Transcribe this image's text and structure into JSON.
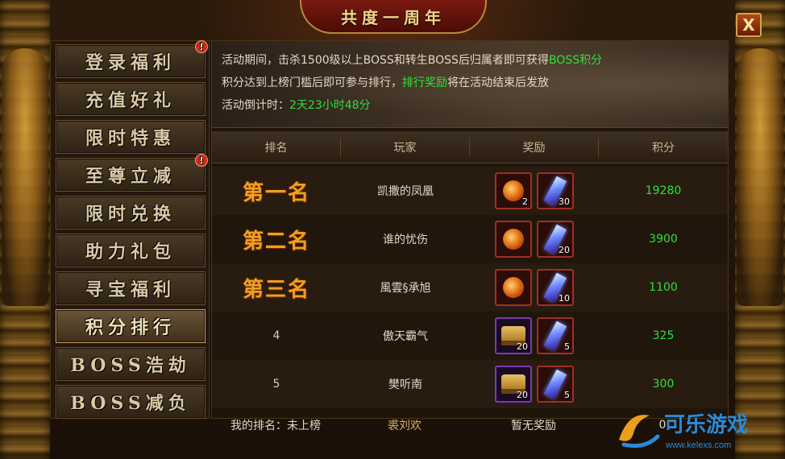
{
  "window": {
    "title": "共度一周年",
    "close_label": "X"
  },
  "sidebar": {
    "items": [
      {
        "label": "登录福利",
        "badge": "!",
        "active": false
      },
      {
        "label": "充值好礼",
        "badge": "",
        "active": false
      },
      {
        "label": "限时特惠",
        "badge": "",
        "active": false
      },
      {
        "label": "至尊立减",
        "badge": "!",
        "active": false
      },
      {
        "label": "限时兑换",
        "badge": "",
        "active": false
      },
      {
        "label": "助力礼包",
        "badge": "",
        "active": false
      },
      {
        "label": "寻宝福利",
        "badge": "",
        "active": false
      },
      {
        "label": "积分排行",
        "badge": "",
        "active": true
      },
      {
        "label": "BOSS浩劫",
        "badge": "",
        "active": false
      },
      {
        "label": "BOSS减负",
        "badge": "",
        "active": false
      }
    ]
  },
  "banner": {
    "line1_prefix": "活动期间，击杀1500级以上BOSS和转生BOSS后归属者即可获得",
    "line1_highlight": "BOSS积分",
    "line2_prefix": "积分达到上榜门槛后即可参与排行，",
    "line2_highlight": "排行奖励",
    "line2_suffix": "将在活动结束后发放",
    "line3_prefix": "活动倒计时：",
    "line3_highlight": "2天23小时48分"
  },
  "table": {
    "headers": {
      "rank": "排名",
      "player": "玩家",
      "reward": "奖励",
      "score": "积分"
    },
    "rows": [
      {
        "rank": "第一名",
        "player": "凯撒的凤凰",
        "score": "19280",
        "rewards": [
          {
            "icon": "potion-icon",
            "qty": "2"
          },
          {
            "icon": "crystal-icon",
            "qty": "30"
          }
        ]
      },
      {
        "rank": "第二名",
        "player": "谁的忧伤",
        "score": "3900",
        "rewards": [
          {
            "icon": "potion-icon",
            "qty": ""
          },
          {
            "icon": "crystal-icon",
            "qty": "20"
          }
        ]
      },
      {
        "rank": "第三名",
        "player": "風雲§承旭",
        "score": "1100",
        "rewards": [
          {
            "icon": "potion-icon",
            "qty": ""
          },
          {
            "icon": "crystal-icon",
            "qty": "10"
          }
        ]
      },
      {
        "rank": "4",
        "player": "傲天霸气",
        "score": "325",
        "rewards": [
          {
            "icon": "chest-icon",
            "qty": "20"
          },
          {
            "icon": "crystal-icon",
            "qty": "5"
          }
        ]
      },
      {
        "rank": "5",
        "player": "樊听南",
        "score": "300",
        "rewards": [
          {
            "icon": "chest-icon",
            "qty": "20"
          },
          {
            "icon": "crystal-icon",
            "qty": "5"
          }
        ]
      }
    ]
  },
  "my_rank": {
    "label": "我的排名：未上榜",
    "player": "裘刘欢",
    "reward": "暂无奖励",
    "score": "0"
  },
  "watermark": {
    "brand": "可乐游戏",
    "url": "www.kelexs.com"
  },
  "colors": {
    "highlight_green": "#2ee03a",
    "rank_gold": "#f0a020",
    "frame_gold": "#b8893a"
  }
}
